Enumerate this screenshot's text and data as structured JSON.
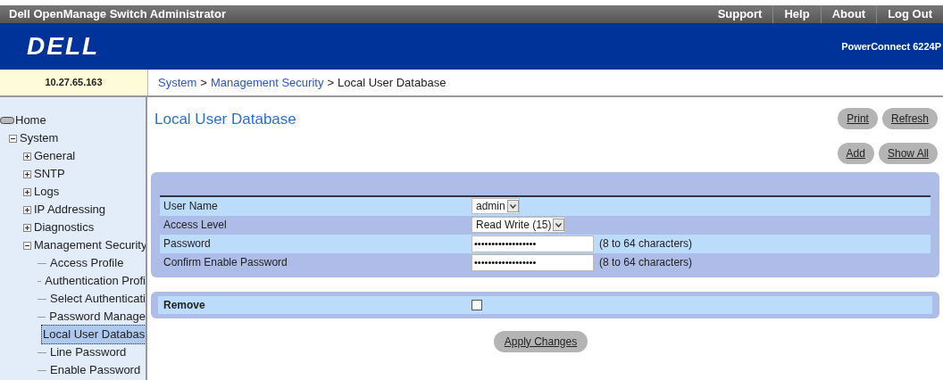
{
  "title_bar": {
    "title": "Dell OpenManage Switch Administrator",
    "links": [
      "Support",
      "Help",
      "About",
      "Log Out"
    ]
  },
  "banner": {
    "logo": "DELL",
    "model": "PowerConnect 6224P"
  },
  "address": "10.27.65.163",
  "breadcrumb": [
    {
      "label": "System",
      "link": true
    },
    {
      "label": ">",
      "link": false
    },
    {
      "label": "Management Security",
      "link": true
    },
    {
      "label": ">",
      "link": false
    },
    {
      "label": "Local User Database",
      "link": false
    }
  ],
  "sidebar": {
    "items": [
      {
        "label": "Home",
        "kind": "home",
        "selected": false
      },
      {
        "label": "System",
        "kind": "folder",
        "expanded": true,
        "selected": false,
        "children": [
          {
            "label": "General",
            "kind": "folder",
            "expanded": false,
            "selected": false
          },
          {
            "label": "SNTP",
            "kind": "folder",
            "expanded": false,
            "selected": false
          },
          {
            "label": "Logs",
            "kind": "folder",
            "expanded": false,
            "selected": false
          },
          {
            "label": "IP Addressing",
            "kind": "folder",
            "expanded": false,
            "selected": false
          },
          {
            "label": "Diagnostics",
            "kind": "folder",
            "expanded": false,
            "selected": false
          },
          {
            "label": "Management Security",
            "kind": "folder",
            "expanded": true,
            "selected": false,
            "children": [
              {
                "label": "Access Profile",
                "kind": "leaf",
                "selected": false
              },
              {
                "label": "Authentication Profi",
                "kind": "leaf",
                "selected": false
              },
              {
                "label": "Select Authenticati",
                "kind": "leaf",
                "selected": false
              },
              {
                "label": "Password Manage",
                "kind": "leaf",
                "selected": false
              },
              {
                "label": "Local User Databas",
                "kind": "leaf",
                "selected": true
              },
              {
                "label": "Line Password",
                "kind": "leaf",
                "selected": false
              },
              {
                "label": "Enable Password",
                "kind": "leaf",
                "selected": false
              }
            ]
          }
        ]
      }
    ]
  },
  "page": {
    "title": "Local User Database",
    "top_buttons": [
      "Print",
      "Refresh"
    ],
    "second_buttons": [
      "Add",
      "Show All"
    ],
    "fields": [
      {
        "label": "User Name",
        "kind": "select",
        "value": "admin"
      },
      {
        "label": "Access Level",
        "kind": "select",
        "value": "Read Write (15)"
      },
      {
        "label": "Password",
        "kind": "password",
        "value": "••••••••••••••••••",
        "hint": "(8 to 64 characters)"
      },
      {
        "label": "Confirm Enable Password",
        "kind": "password",
        "value": "••••••••••••••••••",
        "hint": "(8 to 64 characters)"
      }
    ],
    "remove": {
      "label": "Remove",
      "checked": false
    },
    "apply_button": "Apply Changes"
  }
}
